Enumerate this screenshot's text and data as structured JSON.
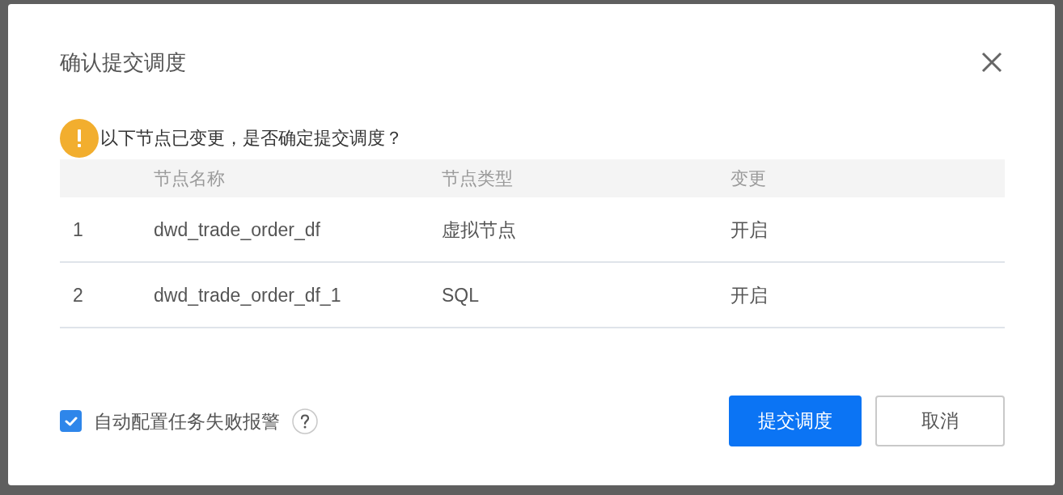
{
  "dialog": {
    "title": "确认提交调度",
    "message": "以下节点已变更，是否确定提交调度？",
    "table": {
      "columns": [
        "",
        "节点名称",
        "节点类型",
        "变更"
      ],
      "rows": [
        {
          "cells": [
            "1",
            "dwd_trade_order_df",
            "虚拟节点",
            "开启"
          ]
        },
        {
          "cells": [
            "2",
            "dwd_trade_order_df_1",
            "SQL",
            "开启"
          ]
        }
      ]
    },
    "alert_option": {
      "label": "自动配置任务失败报警",
      "checked": true
    },
    "buttons": [
      {
        "label": "提交调度",
        "kind": "primary"
      },
      {
        "label": "取消",
        "kind": "default"
      }
    ]
  }
}
